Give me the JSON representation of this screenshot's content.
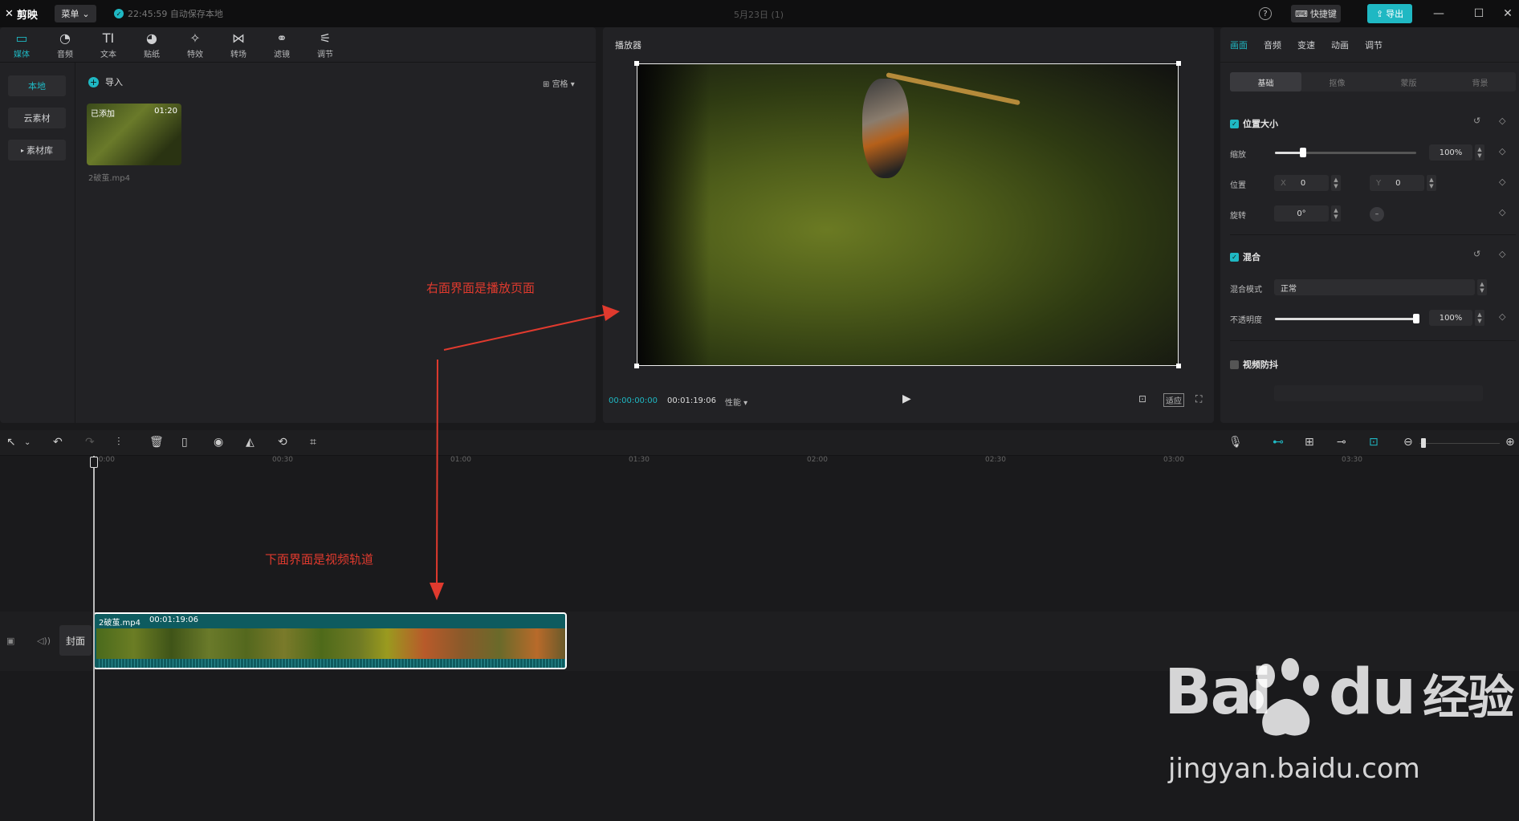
{
  "titlebar": {
    "app_name": "剪映",
    "menu_label": "菜单",
    "autosave_text": "22:45:59 自动保存本地",
    "project_title": "5月23日 (1)",
    "help": "?",
    "shortcut_label": "快捷键",
    "export_label": "导出"
  },
  "media_toolbar": {
    "tabs": [
      {
        "label": "媒体",
        "icon": "media-icon"
      },
      {
        "label": "音频",
        "icon": "audio-icon"
      },
      {
        "label": "文本",
        "icon": "text-icon"
      },
      {
        "label": "贴纸",
        "icon": "sticker-icon"
      },
      {
        "label": "特效",
        "icon": "effects-icon"
      },
      {
        "label": "转场",
        "icon": "transition-icon"
      },
      {
        "label": "滤镜",
        "icon": "filter-icon"
      },
      {
        "label": "调节",
        "icon": "adjust-icon"
      }
    ]
  },
  "media_side": {
    "local": "本地",
    "cloud": "云素材",
    "library": "素材库"
  },
  "media": {
    "import_label": "导入",
    "sort_label": "宫格",
    "item": {
      "tag": "已添加",
      "duration": "01:20",
      "name": "2破茧.mp4"
    }
  },
  "player": {
    "title": "播放器",
    "current_time": "00:00:00:00",
    "total_time": "00:01:19:06",
    "perf_label": "性能",
    "fit_label": "适应"
  },
  "props": {
    "tabs": [
      "画面",
      "音频",
      "变速",
      "动画",
      "调节"
    ],
    "subtabs": [
      "基础",
      "抠像",
      "蒙版",
      "背景"
    ],
    "position_size": {
      "title": "位置大小",
      "scale_label": "缩放",
      "scale_value": "100%",
      "scale_fraction": 0.2,
      "position_label": "位置",
      "x_label": "X",
      "x_value": "0",
      "y_label": "Y",
      "y_value": "0",
      "rotate_label": "旋转",
      "rotate_value": "0°"
    },
    "blend": {
      "title": "混合",
      "mode_label": "混合模式",
      "mode_value": "正常",
      "opacity_label": "不透明度",
      "opacity_value": "100%",
      "opacity_fraction": 1.0
    },
    "stabilize": {
      "title": "视频防抖"
    }
  },
  "timeline": {
    "ticks": [
      "00:00",
      "00:30",
      "01:00",
      "01:30",
      "02:00",
      "02:30",
      "03:00",
      "03:30"
    ],
    "clip": {
      "name": "2破茧.mp4",
      "duration": "00:01:19:06"
    },
    "cover_label": "封面"
  },
  "annotations": {
    "right_note": "右面界面是播放页面",
    "bottom_note": "下面界面是视频轨道"
  },
  "watermark": {
    "brand": "Bai",
    "brand_suffix": "du",
    "cn": "经验",
    "url": "jingyan.baidu.com"
  },
  "colors": {
    "accent": "#1fb8c3",
    "annotation": "#e03a2e",
    "clip_bg": "#0e5b5f"
  }
}
